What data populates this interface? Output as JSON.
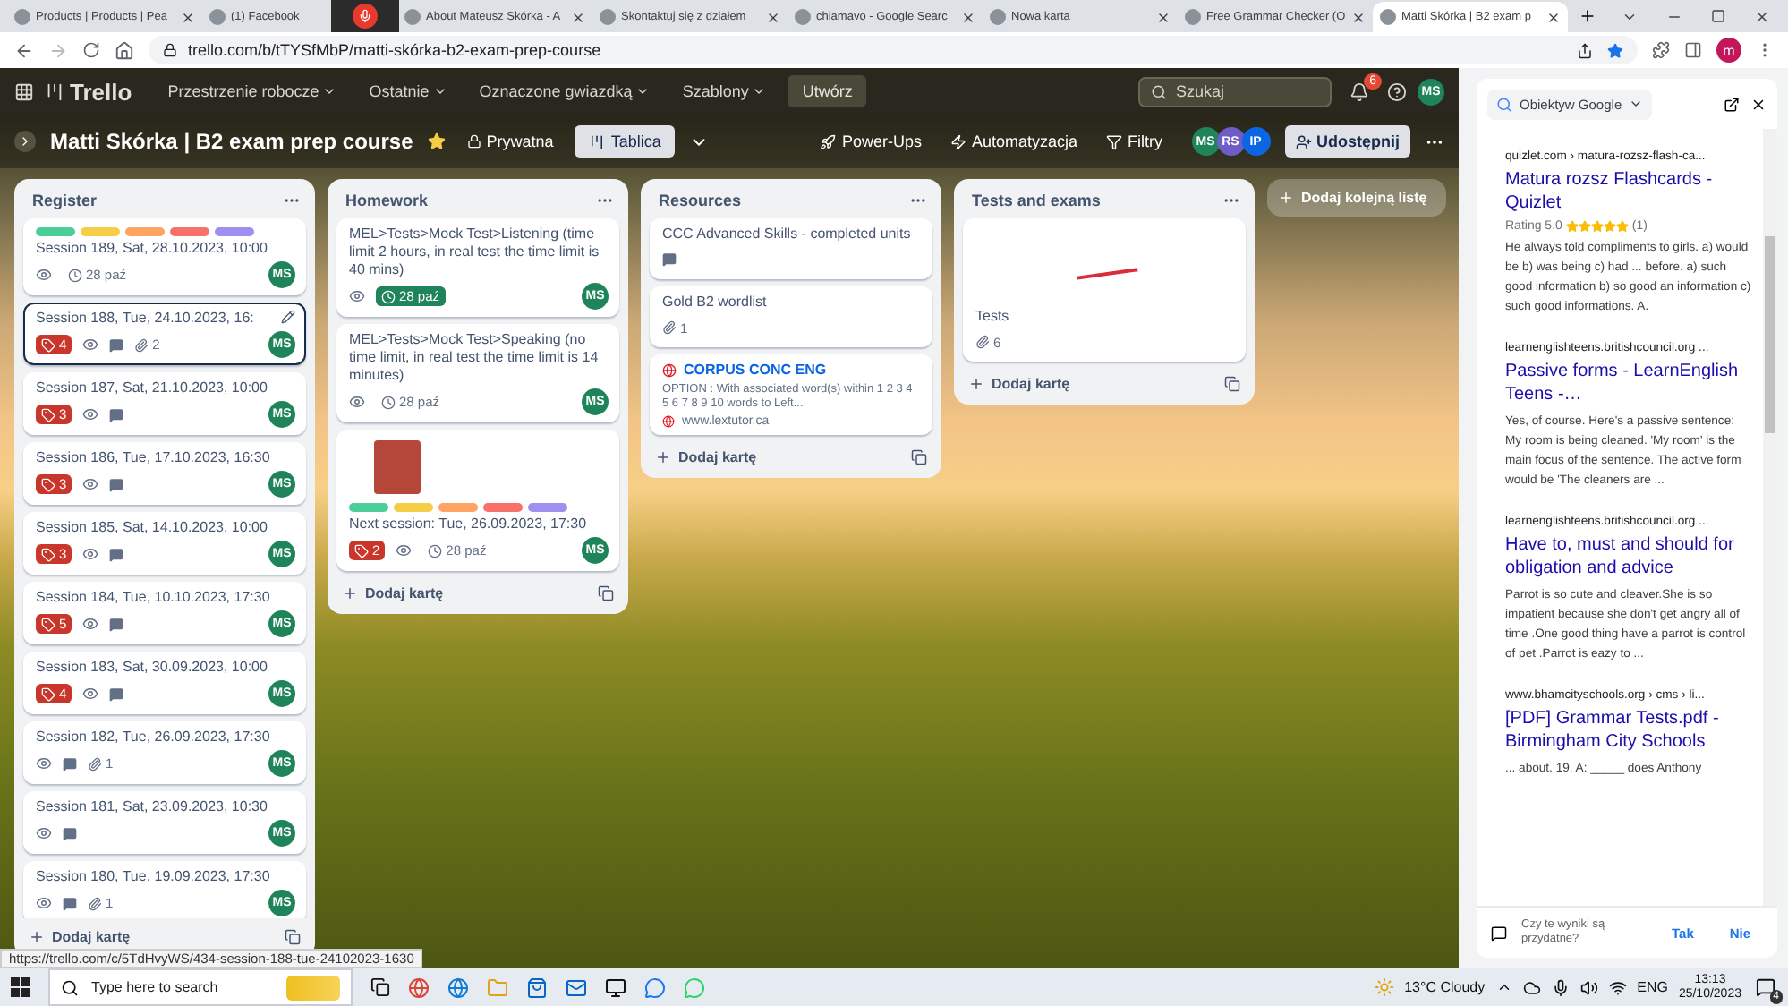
{
  "browser": {
    "tabs": [
      {
        "title": "Products | Products | Pea",
        "selected": false
      },
      {
        "title": "(1) Facebook",
        "selected": false
      },
      {
        "title": "About Mateusz Skórka - A",
        "selected": false
      },
      {
        "title": "Skontaktuj się z działem",
        "selected": false
      },
      {
        "title": "chiamavo - Google Searc",
        "selected": false
      },
      {
        "title": "Nowa karta",
        "selected": false
      },
      {
        "title": "Free Grammar Checker (O",
        "selected": false
      },
      {
        "title": "Matti Skórka | B2 exam p",
        "selected": true
      }
    ],
    "url": "trello.com/b/tTYSfMbP/matti-skórka-b2-exam-prep-course",
    "profile": "m"
  },
  "trello": {
    "logo": "Trello",
    "menus": [
      "Przestrzenie robocze",
      "Ostatnie",
      "Oznaczone gwiazdką",
      "Szablony"
    ],
    "create": "Utwórz",
    "search_placeholder": "Szukaj",
    "notifications": "6",
    "user": "MS"
  },
  "board": {
    "title": "Matti Skórka | B2 exam prep course",
    "starred": true,
    "visibility": "Prywatna",
    "view": "Tablica",
    "actions": [
      {
        "kind": "power-ups",
        "label": "Power-Ups"
      },
      {
        "kind": "automation",
        "label": "Automatyzacja"
      },
      {
        "kind": "filter",
        "label": "Filtry"
      }
    ],
    "members": [
      {
        "initials": "MS",
        "color": "#1f845a"
      },
      {
        "initials": "RS",
        "color": "#6e5dc6"
      },
      {
        "initials": "IP",
        "color": "#0c66e4"
      }
    ],
    "share": "Udostępnij"
  },
  "lists": [
    {
      "title": "Register",
      "add_card": "Dodaj kartę",
      "cards": [
        {
          "kind": "text",
          "labels": [
            {
              "color": "#4bce97"
            },
            {
              "color": "#f5cd47"
            },
            {
              "color": "#fea362"
            },
            {
              "color": "#f87168"
            },
            {
              "color": "#9f8fef"
            }
          ],
          "title": "Session 189, Sat, 28.10.2023, 10:00",
          "focused": false,
          "badges": [
            {
              "kind": "watch"
            },
            {
              "kind": "due",
              "text": "28 paź",
              "complete": false
            }
          ],
          "member": "MS"
        },
        {
          "kind": "text",
          "title": "Session 188, Tue, 24.10.2023, 16:",
          "focused": true,
          "badges": [
            {
              "kind": "votes",
              "text": "4"
            },
            {
              "kind": "watch"
            },
            {
              "kind": "comments"
            },
            {
              "kind": "attachments",
              "text": "2"
            }
          ],
          "member": "MS"
        },
        {
          "kind": "text",
          "title": "Session 187, Sat, 21.10.2023, 10:00",
          "focused": false,
          "badges": [
            {
              "kind": "votes",
              "text": "3"
            },
            {
              "kind": "watch"
            },
            {
              "kind": "comments"
            }
          ],
          "member": "MS"
        },
        {
          "kind": "text",
          "title": "Session 186, Tue, 17.10.2023, 16:30",
          "focused": false,
          "badges": [
            {
              "kind": "votes",
              "text": "3"
            },
            {
              "kind": "watch"
            },
            {
              "kind": "comments"
            }
          ],
          "member": "MS"
        },
        {
          "kind": "text",
          "title": "Session 185, Sat, 14.10.2023, 10:00",
          "focused": false,
          "badges": [
            {
              "kind": "votes",
              "text": "3"
            },
            {
              "kind": "watch"
            },
            {
              "kind": "comments"
            }
          ],
          "member": "MS"
        },
        {
          "kind": "text",
          "title": "Session 184, Tue, 10.10.2023, 17:30",
          "focused": false,
          "badges": [
            {
              "kind": "votes",
              "text": "5"
            },
            {
              "kind": "watch"
            },
            {
              "kind": "comments"
            }
          ],
          "member": "MS"
        },
        {
          "kind": "text",
          "title": "Session 183, Sat, 30.09.2023, 10:00",
          "focused": false,
          "badges": [
            {
              "kind": "votes",
              "text": "4"
            },
            {
              "kind": "watch"
            },
            {
              "kind": "comments"
            }
          ],
          "member": "MS"
        },
        {
          "kind": "text",
          "title": "Session 182, Tue, 26.09.2023, 17:30",
          "focused": false,
          "badges": [
            {
              "kind": "watch"
            },
            {
              "kind": "comments"
            },
            {
              "kind": "attachments",
              "text": "1"
            }
          ],
          "member": "MS"
        },
        {
          "kind": "text",
          "title": "Session 181, Sat, 23.09.2023, 10:30",
          "focused": false,
          "badges": [
            {
              "kind": "watch"
            },
            {
              "kind": "comments"
            }
          ],
          "member": "MS"
        },
        {
          "kind": "text",
          "title": "Session 180, Tue, 19.09.2023, 17:30",
          "focused": false,
          "badges": [
            {
              "kind": "watch"
            },
            {
              "kind": "comments"
            },
            {
              "kind": "attachments",
              "text": "1"
            }
          ],
          "member": "MS"
        }
      ]
    },
    {
      "title": "Homework",
      "add_card": "Dodaj kartę",
      "cards": [
        {
          "kind": "text",
          "title": "MEL>Tests>Mock Test>Listening (time limit 2 hours, in real test the time limit is 40 mins)",
          "focused": false,
          "badges": [
            {
              "kind": "watch"
            },
            {
              "kind": "due",
              "text": "28 paź",
              "complete": true
            }
          ],
          "member": "MS"
        },
        {
          "kind": "text",
          "title": "MEL>Tests>Mock Test>Speaking (no time limit, in real test the time limit is 14 minutes)",
          "focused": false,
          "badges": [
            {
              "kind": "watch"
            },
            {
              "kind": "due",
              "text": "28 paź",
              "complete": false
            }
          ],
          "member": "MS"
        },
        {
          "kind": "photo",
          "labels": [
            {
              "color": "#4bce97"
            },
            {
              "color": "#f5cd47"
            },
            {
              "color": "#fea362"
            },
            {
              "color": "#f87168"
            },
            {
              "color": "#9f8fef"
            }
          ],
          "title": "Next session: Tue, 26.09.2023, 17:30",
          "focused": false,
          "badges": [
            {
              "kind": "votes",
              "text": "2"
            },
            {
              "kind": "watch"
            },
            {
              "kind": "due",
              "text": "28 paź",
              "complete": false
            }
          ],
          "member": "MS"
        }
      ]
    },
    {
      "title": "Resources",
      "add_card": "Dodaj kartę",
      "cards": [
        {
          "kind": "text",
          "title": "CCC Advanced Skills - completed units",
          "focused": false,
          "badges": [
            {
              "kind": "comments"
            }
          ]
        },
        {
          "kind": "text",
          "title": "Gold B2 wordlist",
          "focused": false,
          "badges": [
            {
              "kind": "attachments",
              "text": "1"
            }
          ]
        },
        {
          "kind": "link",
          "title": "CORPUS CONC ENG",
          "description": "OPTION :   With associated word(s) within 1 2 3 4 5 6 7 8 9 10 words to Left...",
          "domain": "www.lextutor.ca",
          "focused": false
        }
      ]
    },
    {
      "title": "Tests and exams",
      "add_card": "Dodaj kartę",
      "cards": [
        {
          "kind": "sticker",
          "title": "Tests",
          "focused": false,
          "badges": [
            {
              "kind": "attachments",
              "text": "6"
            }
          ]
        }
      ]
    }
  ],
  "add_list": "Dodaj kolejną listę",
  "status_url": "https://trello.com/c/5TdHvyWS/434-session-188-tue-24102023-1630",
  "lens": {
    "title": "Obiektyw Google",
    "results": [
      {
        "source": "quizlet.com › matura-rozsz-flash-ca...",
        "title": "Matura rozsz Flashcards - Quizlet",
        "rating": {
          "text": "Rating 5.0",
          "stars": 5,
          "count": "(1)"
        },
        "snippet": "He always told compliments to girls. a) would be b) was being c) had ... before. a) such good information b) so good an information c) such good informations. A."
      },
      {
        "source": "learnenglishteens.britishcouncil.org ...",
        "title": "Passive forms - LearnEnglish Teens -…",
        "snippet": "Yes, of course. Here's a passive sentence: My room is being cleaned. 'My room' is the main focus of the sentence. The active form would be 'The cleaners are ..."
      },
      {
        "source": "learnenglishteens.britishcouncil.org ...",
        "title": "Have to, must and should for obligation and advice",
        "snippet": "Parrot is so cute and cleaver.She is so impatient because she don't get angry all of time .One good thing have a parrot is control of pet .Parrot is eazy to ..."
      },
      {
        "source": "www.bhamcityschools.org › cms › li...",
        "title": "[PDF] Grammar Tests.pdf - Birmingham City Schools",
        "snippet": "... about. 19. A: _____ does Anthony"
      }
    ],
    "feedback": "Czy te wyniki są przydatne?",
    "yes": "Tak",
    "no": "Nie"
  },
  "taskbar": {
    "search_placeholder": "Type here to search",
    "weather": "13°C  Cloudy",
    "language": "ENG",
    "time": "13:13",
    "date": "25/10/2023",
    "notifications": "4"
  }
}
